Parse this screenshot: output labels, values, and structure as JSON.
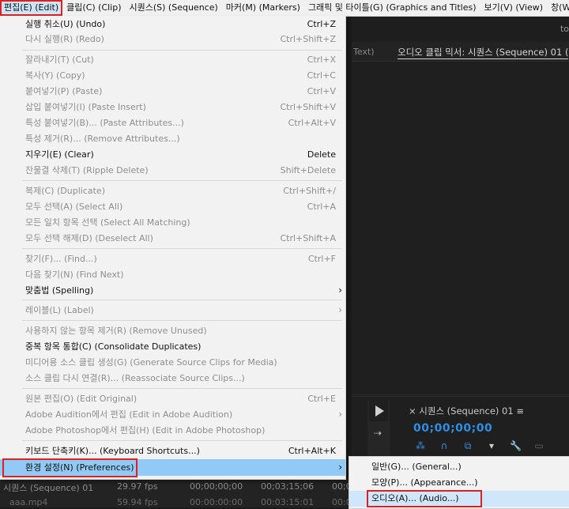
{
  "menubar": [
    {
      "label": "편집(E) (Edit)"
    },
    {
      "label": "클립(C) (Clip)"
    },
    {
      "label": "시퀀스(S) (Sequence)"
    },
    {
      "label": "마커(M) (Markers)"
    },
    {
      "label": "그래픽 및 타이틀(G) (Graphics and Titles)"
    },
    {
      "label": "보기(V) (View)"
    },
    {
      "label": "창(W) (Wi"
    }
  ],
  "edit_menu": {
    "items": [
      {
        "label": "실행 취소(U) (Undo)",
        "shortcut": "Ctrl+Z"
      },
      {
        "label": "다시 실행(R) (Redo)",
        "shortcut": "Ctrl+Shift+Z"
      },
      {
        "label": "잘라내기(T) (Cut)",
        "shortcut": "Ctrl+X"
      },
      {
        "label": "복사(Y) (Copy)",
        "shortcut": "Ctrl+C"
      },
      {
        "label": "붙여넣기(P) (Paste)",
        "shortcut": "Ctrl+V"
      },
      {
        "label": "삽입 붙여넣기(I) (Paste Insert)",
        "shortcut": "Ctrl+Shift+V"
      },
      {
        "label": "특성 붙여넣기(B)... (Paste Attributes...)",
        "shortcut": "Ctrl+Alt+V"
      },
      {
        "label": "특성 제거(R)... (Remove Attributes...)",
        "shortcut": ""
      },
      {
        "label": "지우기(E) (Clear)",
        "shortcut": "Delete"
      },
      {
        "label": "잔물결 삭제(T) (Ripple Delete)",
        "shortcut": "Shift+Delete"
      },
      {
        "label": "복제(C) (Duplicate)",
        "shortcut": "Ctrl+Shift+/"
      },
      {
        "label": "모두 선택(A) (Select All)",
        "shortcut": "Ctrl+A"
      },
      {
        "label": "모든 일치 항목 선택 (Select All Matching)",
        "shortcut": ""
      },
      {
        "label": "모두 선택 해제(D) (Deselect All)",
        "shortcut": "Ctrl+Shift+A"
      },
      {
        "label": "찾기(F)... (Find...)",
        "shortcut": "Ctrl+F"
      },
      {
        "label": "다음 찾기(N) (Find Next)",
        "shortcut": ""
      },
      {
        "label": "맞춤법 (Spelling)",
        "shortcut": ""
      },
      {
        "label": "레이블(L) (Label)",
        "shortcut": ""
      },
      {
        "label": "사용하지 않는 항목 제거(R) (Remove Unused)",
        "shortcut": ""
      },
      {
        "label": "중복 항목 통합(C) (Consolidate Duplicates)",
        "shortcut": ""
      },
      {
        "label": "미디어용 소스 클립 생성(G) (Generate Source Clips for Media)",
        "shortcut": ""
      },
      {
        "label": "소스 클립 다시 연결(R)... (Reassociate Source Clips...)",
        "shortcut": ""
      },
      {
        "label": "원본 편집(O) (Edit Original)",
        "shortcut": "Ctrl+E"
      },
      {
        "label": "Adobe Audition에서 편집 (Edit in Adobe Audition)",
        "shortcut": ""
      },
      {
        "label": "Adobe Photoshop에서 편집(H) (Edit in Adobe Photoshop)",
        "shortcut": ""
      },
      {
        "label": "키보드 단축키(K)... (Keyboard Shortcuts...)",
        "shortcut": "Ctrl+Alt+K"
      },
      {
        "label": "환경 설정(N) (Preferences)",
        "shortcut": ""
      }
    ],
    "submenu_arrow": "›"
  },
  "preferences_submenu": [
    {
      "label": "일반(G)... (General...)"
    },
    {
      "label": "모양(P)... (Appearance...)"
    },
    {
      "label": "오디오(A)... (Audio...)"
    }
  ],
  "app": {
    "top_text": "to",
    "tab_text": "Text)",
    "mixer_tab": "오디오 클립 믹서: 시퀀스 (Sequence) 01 (",
    "sequence_title": "× 시퀀스 (Sequence) 01 ≡",
    "timecode": "00;00;00;00",
    "timeline_icons": [
      "snap-icon",
      "magnet-icon",
      "linked-selection-icon",
      "marker-icon",
      "wrench-icon",
      "captions-icon"
    ],
    "colors": {
      "timecode": "#2f8ee8",
      "highlight": "#91c9f7",
      "annotation_red": "#e02020"
    }
  },
  "project_rows": [
    {
      "name": "시퀀스 (Sequence) 01",
      "fps": "29.97 fps",
      "start": "00;00;00;00",
      "end": "00;03;15;06",
      "extra": "00;0"
    },
    {
      "name": "aaa.mp4",
      "fps": "59.94 fps",
      "start": "00:00:00:00",
      "end": "00:03:15:01",
      "extra": "00:0"
    }
  ]
}
